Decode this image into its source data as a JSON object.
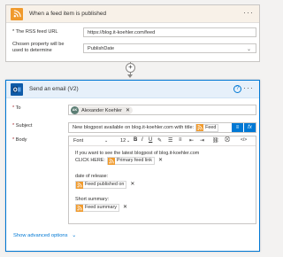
{
  "trigger": {
    "title": "When a feed item is published",
    "feed_url_label": "* The RSS feed URL",
    "feed_url_value": "https://blog.it-koehler.com/feed",
    "property_label_line1": "Chosen property will be",
    "property_label_line2": "used to determine",
    "property_value": "PublishDate"
  },
  "connector": {
    "add_symbol": "+"
  },
  "action": {
    "title": "Send an email (V2)",
    "help_symbol": "?",
    "more_symbol": "···",
    "to_label": "To",
    "to_person_initials": "AK",
    "to_person_name": "Alexander Koehler",
    "subject_label": "Subject",
    "subject_text": "New blogpost available on blog.it-koehler.com with title:",
    "subject_token": "Feed",
    "body_label": "Body",
    "toolbar": {
      "font": "Font",
      "size": "12",
      "bold": "B",
      "italic": "I",
      "underline": "U",
      "pen": "✎",
      "bullets": "☰",
      "numbered": "≡",
      "outdent": "⇤",
      "indent": "⇥",
      "link": "⛓",
      "unlink": "⛒",
      "code": "</>"
    },
    "body_line1": "If you want to see the latest blogpost of blog.it-koehler.com",
    "body_line2": "CLICK HERE:",
    "body_token1": "Primary feed link",
    "body_release_label": "date of release:",
    "body_token2": "Feed published on",
    "body_summary_label": "Short summary:",
    "body_token3": "Feed summary",
    "show_advanced": "Show advanced options"
  },
  "colors": {
    "rss_orange": "#f09a2c",
    "outlook_blue": "#0f5ba8",
    "accent": "#0078d4"
  },
  "icons": [
    "rss-icon",
    "outlook-icon",
    "help-icon",
    "more-icon",
    "chevron-down-icon",
    "close-icon",
    "expression-icon",
    "dynamic-content-icon"
  ]
}
